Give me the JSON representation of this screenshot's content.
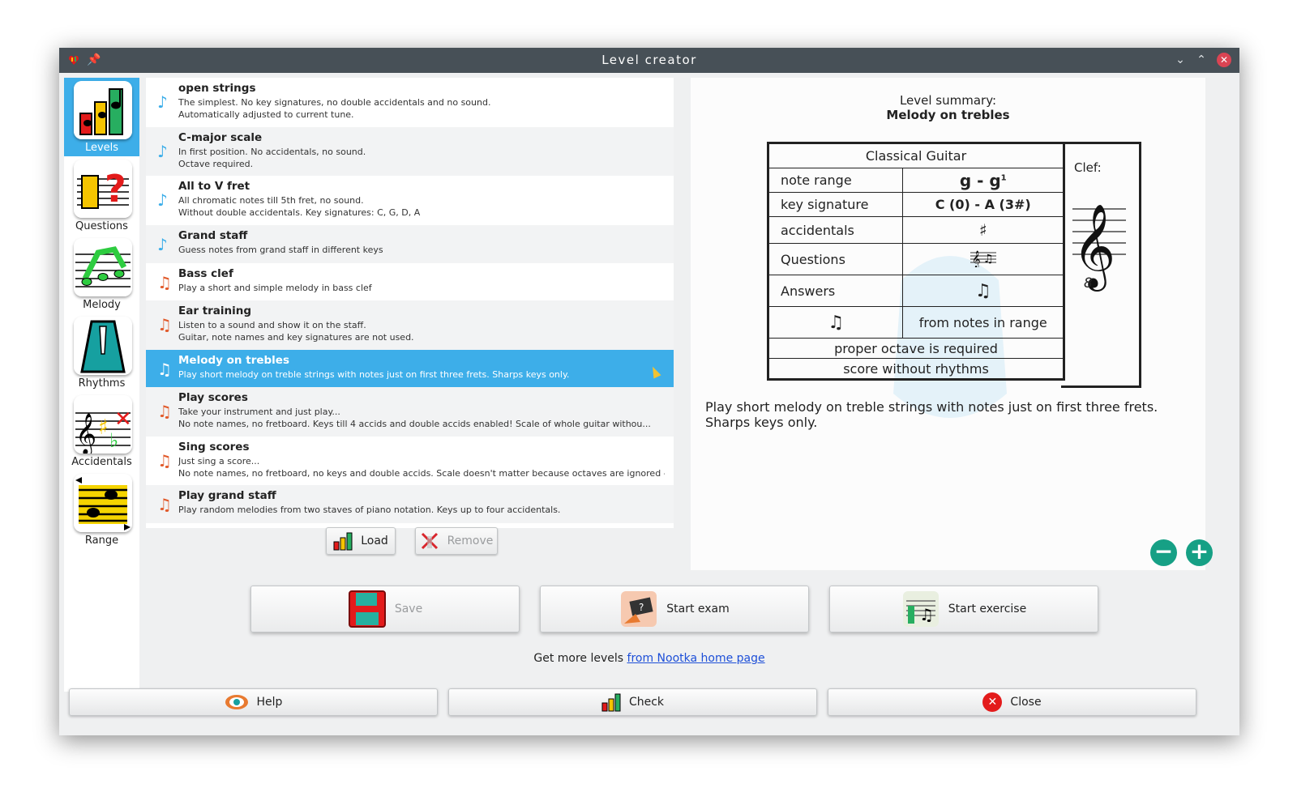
{
  "window": {
    "title": "Level creator"
  },
  "colors": {
    "accent": "#3daee9",
    "titlebar": "#475057",
    "close": "#da4453",
    "zoom": "#16a085",
    "link": "#1d4fd8"
  },
  "sidebar": {
    "items": [
      {
        "label": "Levels",
        "icon": "levels-icon",
        "active": true
      },
      {
        "label": "Questions",
        "icon": "questions-icon"
      },
      {
        "label": "Melody",
        "icon": "melody-icon"
      },
      {
        "label": "Rhythms",
        "icon": "metronome-icon"
      },
      {
        "label": "Accidentals",
        "icon": "accidentals-icon"
      },
      {
        "label": "Range",
        "icon": "range-icon"
      }
    ]
  },
  "levels": [
    {
      "name": "open strings",
      "desc1": "The simplest. No key signatures, no double accidentals and no sound.",
      "desc2": "Automatically adjusted to current tune."
    },
    {
      "name": "C-major scale",
      "desc1": "In first position. No accidentals, no sound.",
      "desc2": "Octave required."
    },
    {
      "name": "All to V fret",
      "desc1": "All chromatic notes till 5th fret, no sound.",
      "desc2": "Without double accidentals. Key signatures: C, G, D, A"
    },
    {
      "name": "Grand staff",
      "desc1": "Guess notes from grand staff in different keys",
      "desc2": ""
    },
    {
      "name": "Bass clef",
      "desc1": "Play a short and simple melody in bass clef",
      "desc2": ""
    },
    {
      "name": "Ear training",
      "desc1": "Listen to a sound and show it on the staff.",
      "desc2": "Guitar, note names and key signatures are not used."
    },
    {
      "name": "Melody on trebles",
      "desc1": "Play short melody on treble strings with notes just on first three frets. Sharps keys only.",
      "desc2": ""
    },
    {
      "name": "Play scores",
      "desc1": "Take your instrument and just play...",
      "desc2": "No note names, no fretboard. Keys till 4 accids and double accids enabled! Scale of whole guitar withou..."
    },
    {
      "name": "Sing scores",
      "desc1": "Just sing a score...",
      "desc2": "No note names, no fretboard, no keys and double accids. Scale doesn't matter because octaves are ignored - y..."
    },
    {
      "name": "Play grand staff",
      "desc1": "Play random melodies from two staves of piano notation. Keys up to four accidentals.",
      "desc2": ""
    }
  ],
  "list_buttons": {
    "load": "Load",
    "remove": "Remove"
  },
  "summary": {
    "heading": "Level summary:",
    "level_name": "Melody on trebles",
    "instrument": "Classical Guitar",
    "rows": {
      "note_range_label": "note range",
      "note_range_value": "g - g",
      "note_range_sup": "1",
      "key_signature_label": "key signature",
      "key_signature_value": "C (0) - A (3#)",
      "accidentals_label": "accidentals",
      "accidentals_value": "♯",
      "questions_label": "Questions",
      "answers_label": "Answers",
      "answers_value": "♫",
      "melody_symbol": "♫",
      "melody_value": "from notes in range",
      "octave": "proper octave is required",
      "rhythms": "score without rhythms"
    },
    "clef_label": "Clef:",
    "clef_symbol": "𝄞",
    "clef_octave": "8",
    "description_1": "Play short melody on treble strings with notes just on first three frets.",
    "description_2": "Sharps keys only.",
    "zoom_out": "−",
    "zoom_in": "+"
  },
  "actions": {
    "save": "Save",
    "start_exam": "Start exam",
    "start_exercise": "Start exercise"
  },
  "more": {
    "text": "Get more levels",
    "link": "from Nootka home page"
  },
  "bottom": {
    "help": "Help",
    "check": "Check",
    "close": "Close"
  }
}
